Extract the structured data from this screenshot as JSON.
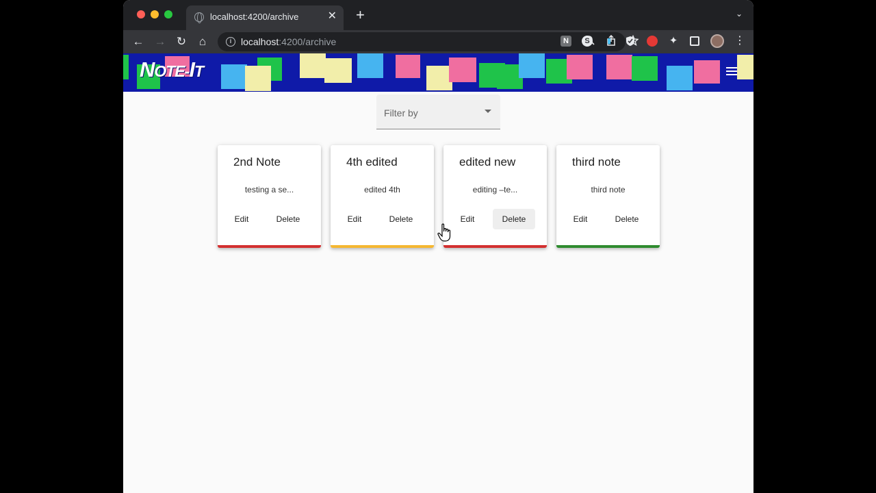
{
  "browser": {
    "tab_title": "localhost:4200/archive",
    "tab_close": "✕",
    "new_tab": "+",
    "tab_menu": "⌄",
    "url_host": "localhost",
    "url_rest": ":4200/archive",
    "nav": {
      "back": "←",
      "forward": "→",
      "reload": "↻",
      "home": "⌂"
    },
    "icons": {
      "zoom": "search-icon",
      "share": "share-icon",
      "star": "star-icon"
    }
  },
  "app": {
    "logo": "Note-It",
    "logo_first": "N",
    "logo_rest": "OTE-",
    "logo_second": "I",
    "logo_tail": "T",
    "colors": {
      "header": "#0f1aa8",
      "yellow": "#f2eeaa",
      "blue": "#46b4f0",
      "pink": "#f06ea0",
      "green": "#1fc34a"
    }
  },
  "filter": {
    "label": "Filter by"
  },
  "notes": [
    {
      "title": "2nd Note",
      "body": "testing a se...",
      "edit": "Edit",
      "delete": "Delete",
      "bar_color": "#d32f2f"
    },
    {
      "title": "4th edited",
      "body": "edited 4th",
      "edit": "Edit",
      "delete": "Delete",
      "bar_color": "#f5b731"
    },
    {
      "title": "edited new",
      "body": "editing –te...",
      "edit": "Edit",
      "delete": "Delete",
      "bar_color": "#d32f2f"
    },
    {
      "title": "third note",
      "body": "third note",
      "edit": "Edit",
      "delete": "Delete",
      "bar_color": "#2e8b2e"
    }
  ]
}
